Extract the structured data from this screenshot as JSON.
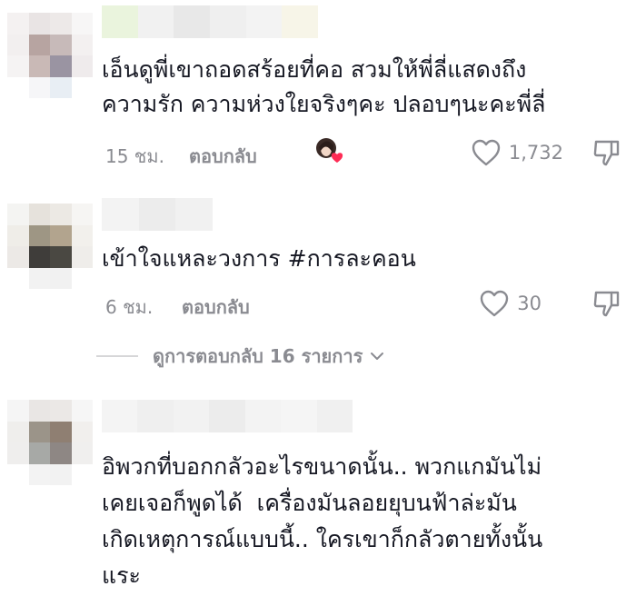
{
  "comments": [
    {
      "text": "เอ็นดูพี่เขาถอดสร้อยที่คอ สวมให้พี่ลี่แสดงถึง\nความรัก ความห่วงใยจริงๆคะ ปลอบๆนะคะพี่ลี่",
      "time": "15 ชม.",
      "reply_label": "ตอบกลับ",
      "likes": "1,732",
      "liked_by_creator": true
    },
    {
      "text": "เข้าใจแหละวงการ #การละคอน",
      "time": "6 ชม.",
      "reply_label": "ตอบกลับ",
      "likes": "30",
      "liked_by_creator": false
    },
    {
      "text": "อิพวกที่บอกกลัวอะไรขนาดนั้น.. พวกแกมันไม่\nเคยเจอก็พูดได้  เครื่องมันลอยยุบนฟ้าล่ะมัน\nเกิดเหตุการณ์แบบนี้.. ใครเขาก็กลัวตายทั้งนั้น\nแระ"
    }
  ],
  "view_replies": {
    "label": "ดูการตอบกลับ 16 รายการ"
  },
  "icons": {
    "like": "heart-outline-icon",
    "dislike": "thumbs-down-icon",
    "creator_like": "creator-heart-avatar-icon",
    "expand": "chevron-down-icon"
  },
  "colors": {
    "text": "#161823",
    "secondary": "#8a8b91",
    "heart": "#fe2c55",
    "divider": "#d6d6d8"
  }
}
